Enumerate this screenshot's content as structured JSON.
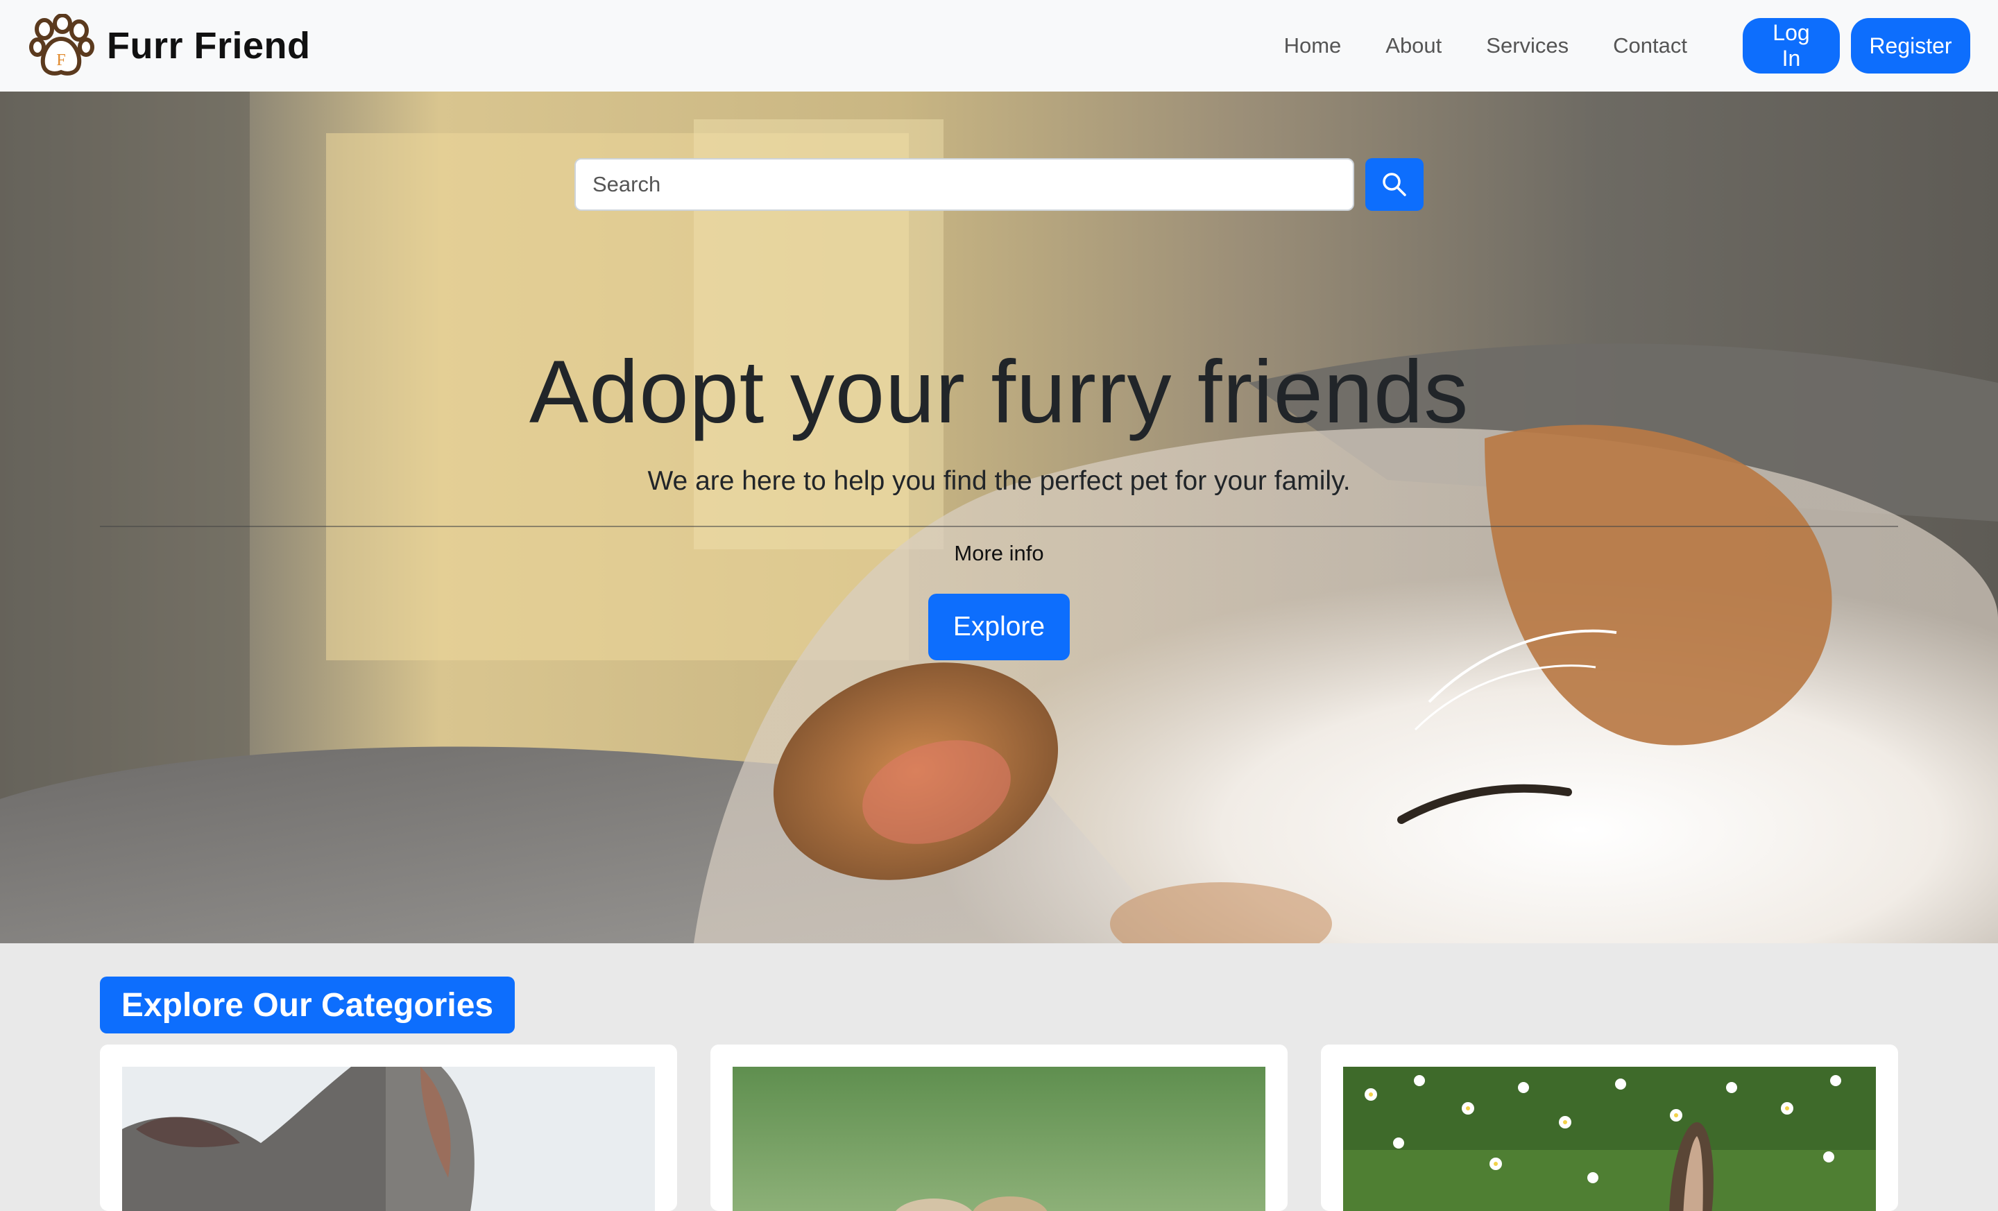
{
  "brand": {
    "name": "Furr Friend",
    "logo_icon": "paw-icon",
    "logo_letter": "F"
  },
  "nav": {
    "links": [
      "Home",
      "About",
      "Services",
      "Contact"
    ],
    "login_label": "Log In",
    "register_label": "Register"
  },
  "hero": {
    "search_placeholder": "Search",
    "search_icon": "search-icon",
    "title": "Adopt your furry friends",
    "subtitle": "We are here to help you find the perfect pet for your family.",
    "more_info": "More info",
    "explore_label": "Explore",
    "image": "sleeping-dog-photo"
  },
  "categories": {
    "heading": "Explore Our Categories",
    "cards": [
      {
        "image": "cat-photo"
      },
      {
        "image": "puppies-photo"
      },
      {
        "image": "rabbit-in-daisies-photo"
      }
    ]
  },
  "colors": {
    "primary": "#0d6efd",
    "navbar_bg": "#f8f9fa",
    "section_bg": "#e9e9e9",
    "paw_brown": "#5b3a1e",
    "paw_letter": "#e08a2e"
  }
}
